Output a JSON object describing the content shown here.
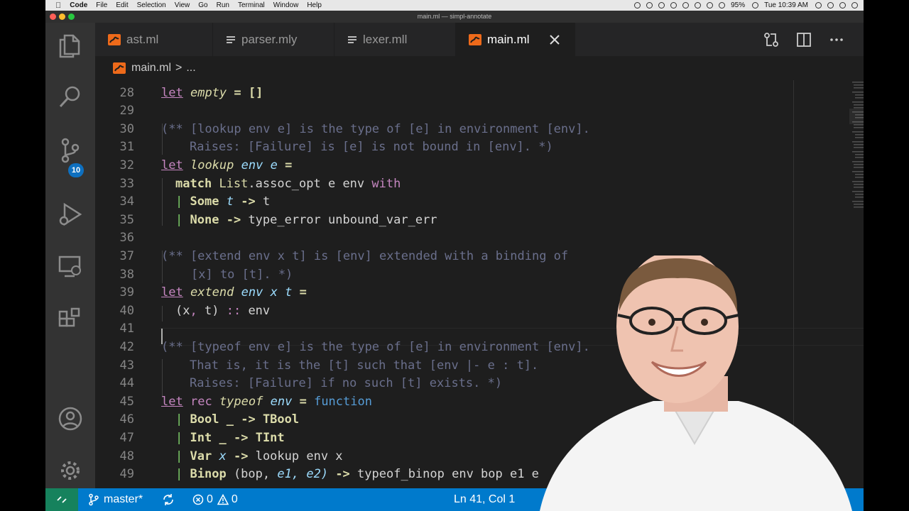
{
  "mac_menubar": {
    "app_name": "Code",
    "menus": [
      "File",
      "Edit",
      "Selection",
      "View",
      "Go",
      "Run",
      "Terminal",
      "Window",
      "Help"
    ],
    "battery": "95%",
    "clock": "Tue 10:39 AM"
  },
  "window": {
    "title": "main.ml — simpl-annotate"
  },
  "activity_bar": {
    "scm_badge": "10"
  },
  "tabs": [
    {
      "label": "ast.ml",
      "icon": "ocaml-file-icon"
    },
    {
      "label": "parser.mly",
      "icon": "menhir-file-icon"
    },
    {
      "label": "lexer.mll",
      "icon": "ocamllex-file-icon"
    },
    {
      "label": "main.ml",
      "icon": "ocaml-file-icon",
      "active": true
    }
  ],
  "breadcrumb": {
    "file": "main.ml",
    "separator": ">",
    "rest": "..."
  },
  "editor": {
    "cursor_line": 41,
    "lines": [
      {
        "n": "28"
      },
      {
        "n": "29"
      },
      {
        "n": "30",
        "t1": "(** [lookup env e] is the type of [e] in environment [env]."
      },
      {
        "n": "31",
        "t1": "Raises: [Failure] is [e] is not bound in [env]. *)"
      },
      {
        "n": "32",
        "t1": "let",
        "t2": "lookup",
        "t3": "env",
        "t4": "e",
        "t5": "="
      },
      {
        "n": "33",
        "t1": "match",
        "t2": "List",
        "t3": ".assoc_opt e env",
        "t4": "with"
      },
      {
        "n": "34",
        "t1": "|",
        "t2": "Some",
        "t3": "t",
        "t4": "->",
        "t5": "t"
      },
      {
        "n": "35",
        "t1": "|",
        "t2": "None",
        "t3": "->",
        "t4": "type_error unbound_var_err"
      },
      {
        "n": "36"
      },
      {
        "n": "37",
        "t1": "(** [extend env x t] is [env] extended with a binding of"
      },
      {
        "n": "38",
        "t1": "[x] to [t]. *)"
      },
      {
        "n": "39",
        "t1": "let",
        "t2": "extend",
        "t3": "env",
        "t4": "x",
        "t5": "t",
        "t6": "="
      },
      {
        "n": "40",
        "t1": "(x",
        "t2": ",",
        "t3": " t)",
        "t4": "::",
        "t5": "env"
      },
      {
        "n": "41"
      },
      {
        "n": "42",
        "t1": "(** [typeof env e] is the type of [e] in environment [env]."
      },
      {
        "n": "43",
        "t1": "That is, it is the [t] such that [env |- e : t]."
      },
      {
        "n": "44",
        "t1": "Raises: [Failure] if no such [t] exists. *)"
      },
      {
        "n": "45",
        "t1": "let",
        "t2": "rec",
        "t3": "typeof",
        "t4": "env",
        "t5": "=",
        "t6": "function"
      },
      {
        "n": "46",
        "t1": "|",
        "t2": "Bool",
        "t3": "_",
        "t4": "->",
        "t5": "TBool"
      },
      {
        "n": "47",
        "t1": "|",
        "t2": "Int",
        "t3": "_",
        "t4": "->",
        "t5": "TInt"
      },
      {
        "n": "48",
        "t1": "|",
        "t2": "Var",
        "t3": "x",
        "t4": "->",
        "t5": "lookup env x"
      },
      {
        "n": "49",
        "t1": "|",
        "t2": "Binop",
        "t3": "(bop,",
        "t4": "e1,",
        "t5": "e2)",
        "t6": "->",
        "t7": "typeof_binop env bop e1 e"
      }
    ],
    "line28": {
      "t1": "let",
      "t2": "empty",
      "t3": "=",
      "t4": "[]"
    }
  },
  "status_bar": {
    "branch": "master*",
    "errors": "0",
    "warnings": "0",
    "position": "Ln 41, Col 1"
  },
  "colors": {
    "accent": "#007acc",
    "remote": "#16825d",
    "editor_bg": "#1e1e1e",
    "keyword": "#c586c0",
    "comment": "#6a6f8c"
  }
}
